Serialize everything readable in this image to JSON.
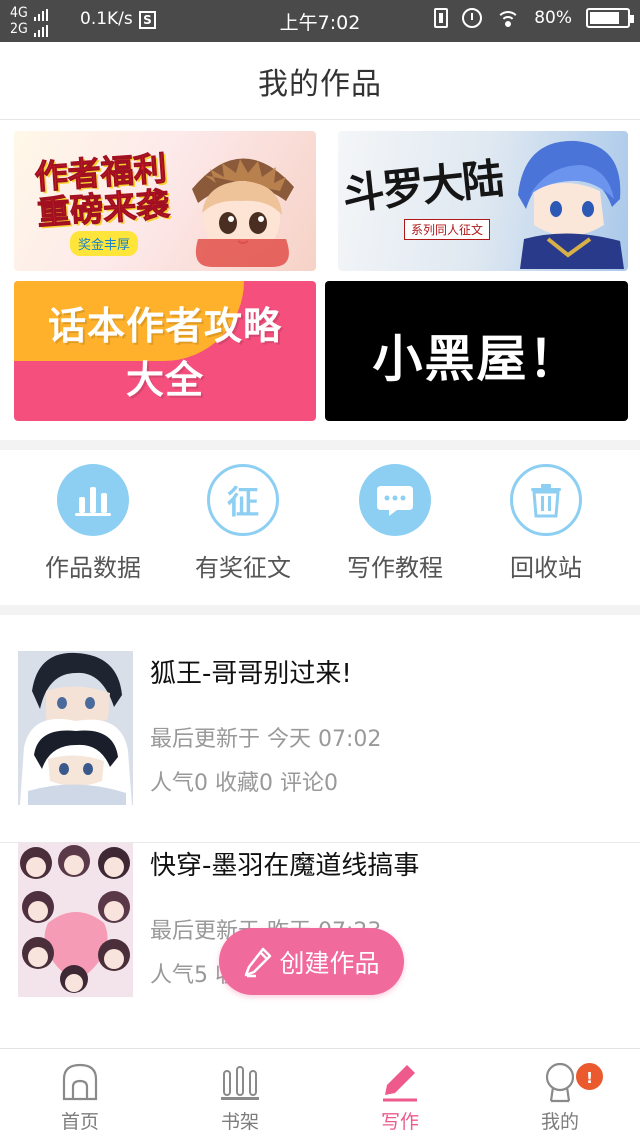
{
  "status_bar": {
    "network_top": "4G",
    "network_bottom": "2G",
    "speed": "0.1K/s",
    "s_icon_label": "S",
    "time": "上午7:02",
    "battery": "80%",
    "battery_level": 0.8
  },
  "header": {
    "title": "我的作品"
  },
  "banners": {
    "welfare": {
      "line1": "作者福利",
      "line2": "重磅来袭",
      "tag": "奖金丰厚"
    },
    "douluo": {
      "title": "斗罗大陆",
      "subtitle": "系列同人征文"
    },
    "guide": {
      "line1": "话本作者攻略",
      "line2": "大全"
    },
    "blackroom": {
      "text": "小黑屋！"
    }
  },
  "actions": [
    {
      "label": "作品数据",
      "icon": "chart-icon"
    },
    {
      "label": "有奖征文",
      "icon": "zheng-icon",
      "glyph": "征"
    },
    {
      "label": "写作教程",
      "icon": "chat-bubble-icon"
    },
    {
      "label": "回收站",
      "icon": "trash-icon"
    }
  ],
  "works": [
    {
      "title": "狐王-哥哥别过来!",
      "updated": "最后更新于 今天 07:02",
      "stats": "人气0 收藏0 评论0"
    },
    {
      "title": "快穿-墨羽在魔道线搞事",
      "updated": "最后更新于 昨天 07:23",
      "stats": "人气5 收藏0 评论2"
    }
  ],
  "fab": {
    "label": "创建作品"
  },
  "nav": {
    "items": [
      {
        "label": "首页",
        "icon": "home-icon"
      },
      {
        "label": "书架",
        "icon": "bookshelf-icon"
      },
      {
        "label": "写作",
        "icon": "pen-icon",
        "active": true
      },
      {
        "label": "我的",
        "icon": "profile-icon"
      }
    ],
    "badge": "!"
  },
  "colors": {
    "accent": "#f06a9b",
    "icon_blue": "#8dcff3",
    "banner_pink": "#f54f7e",
    "banner_black": "#000000"
  }
}
